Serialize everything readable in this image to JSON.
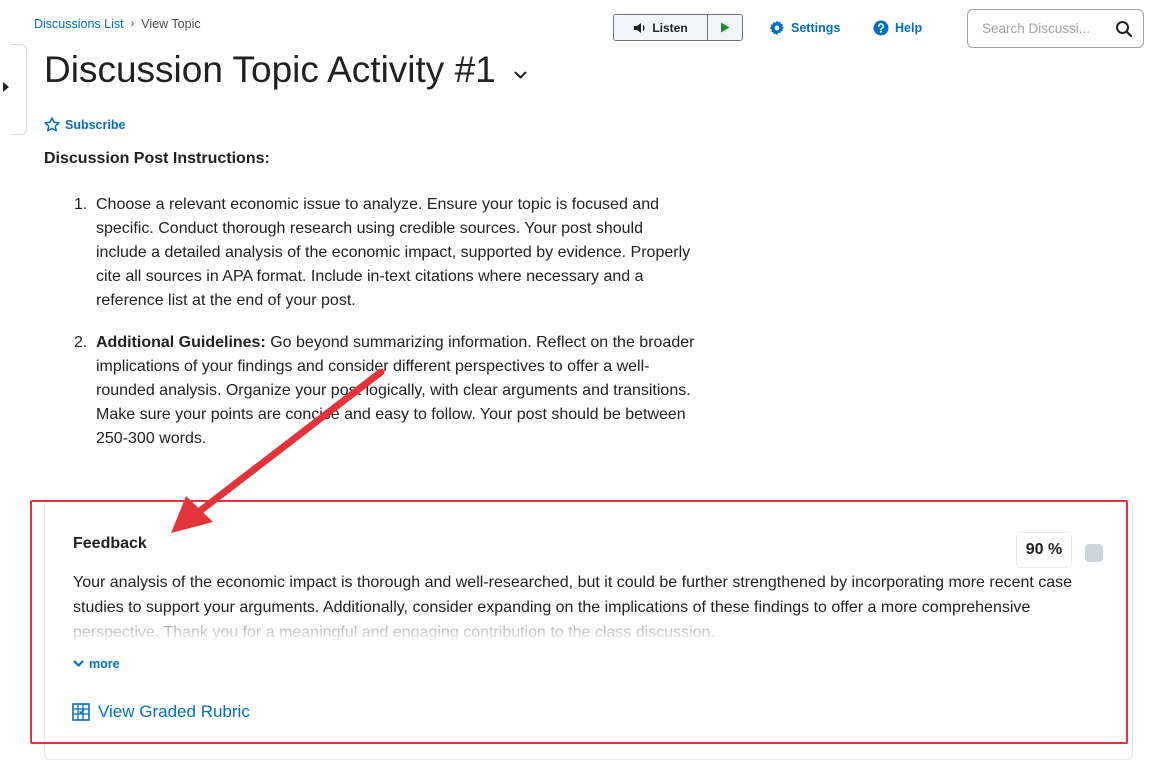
{
  "breadcrumb": {
    "parent": "Discussions List",
    "separator": "›",
    "current": "View Topic"
  },
  "toolbar": {
    "listen_label": "Listen",
    "settings_label": "Settings",
    "help_label": "Help",
    "search_placeholder": "Search Discussi..."
  },
  "topic": {
    "title": "Discussion Topic Activity #1",
    "subscribe_label": "Subscribe"
  },
  "instructions": {
    "heading": "Discussion Post Instructions:",
    "items": [
      {
        "number": "1.",
        "bold": "",
        "text": "Choose a relevant economic issue to analyze. Ensure your topic is focused and specific. Conduct thorough research using credible sources. Your post should include a detailed analysis of the economic impact, supported by evidence. Properly cite all sources in APA format. Include in-text citations where necessary and a reference list at the end of your post."
      },
      {
        "number": "2.",
        "bold": "Additional Guidelines:",
        "text": " Go beyond summarizing information. Reflect on the broader implications of your findings and consider different perspectives to offer a well-rounded analysis. Organize your post logically, with clear arguments and transitions. Make sure your points are concise and easy to follow. Your post should be between 250-300 words."
      }
    ]
  },
  "feedback": {
    "title": "Feedback",
    "score": "90 %",
    "text": "Your analysis of the economic impact is thorough and well-researched, but it could be further strengthened by incorporating more recent case studies to support your arguments. Additionally, consider expanding on the implications of these findings to offer a more comprehensive perspective. Thank you for a meaningful and engaging contribution to the class discussion.",
    "more_label": "more",
    "rubric_label": "View Graded Rubric"
  },
  "colors": {
    "link": "#006fbf",
    "annotation": "#e3333b",
    "text": "#202122"
  },
  "icons": [
    "speaker-icon",
    "play-icon",
    "gear-icon",
    "help-icon",
    "search-icon",
    "star-outline-icon",
    "chevron-down-icon",
    "rubric-icon",
    "collapse-triangle-icon"
  ]
}
